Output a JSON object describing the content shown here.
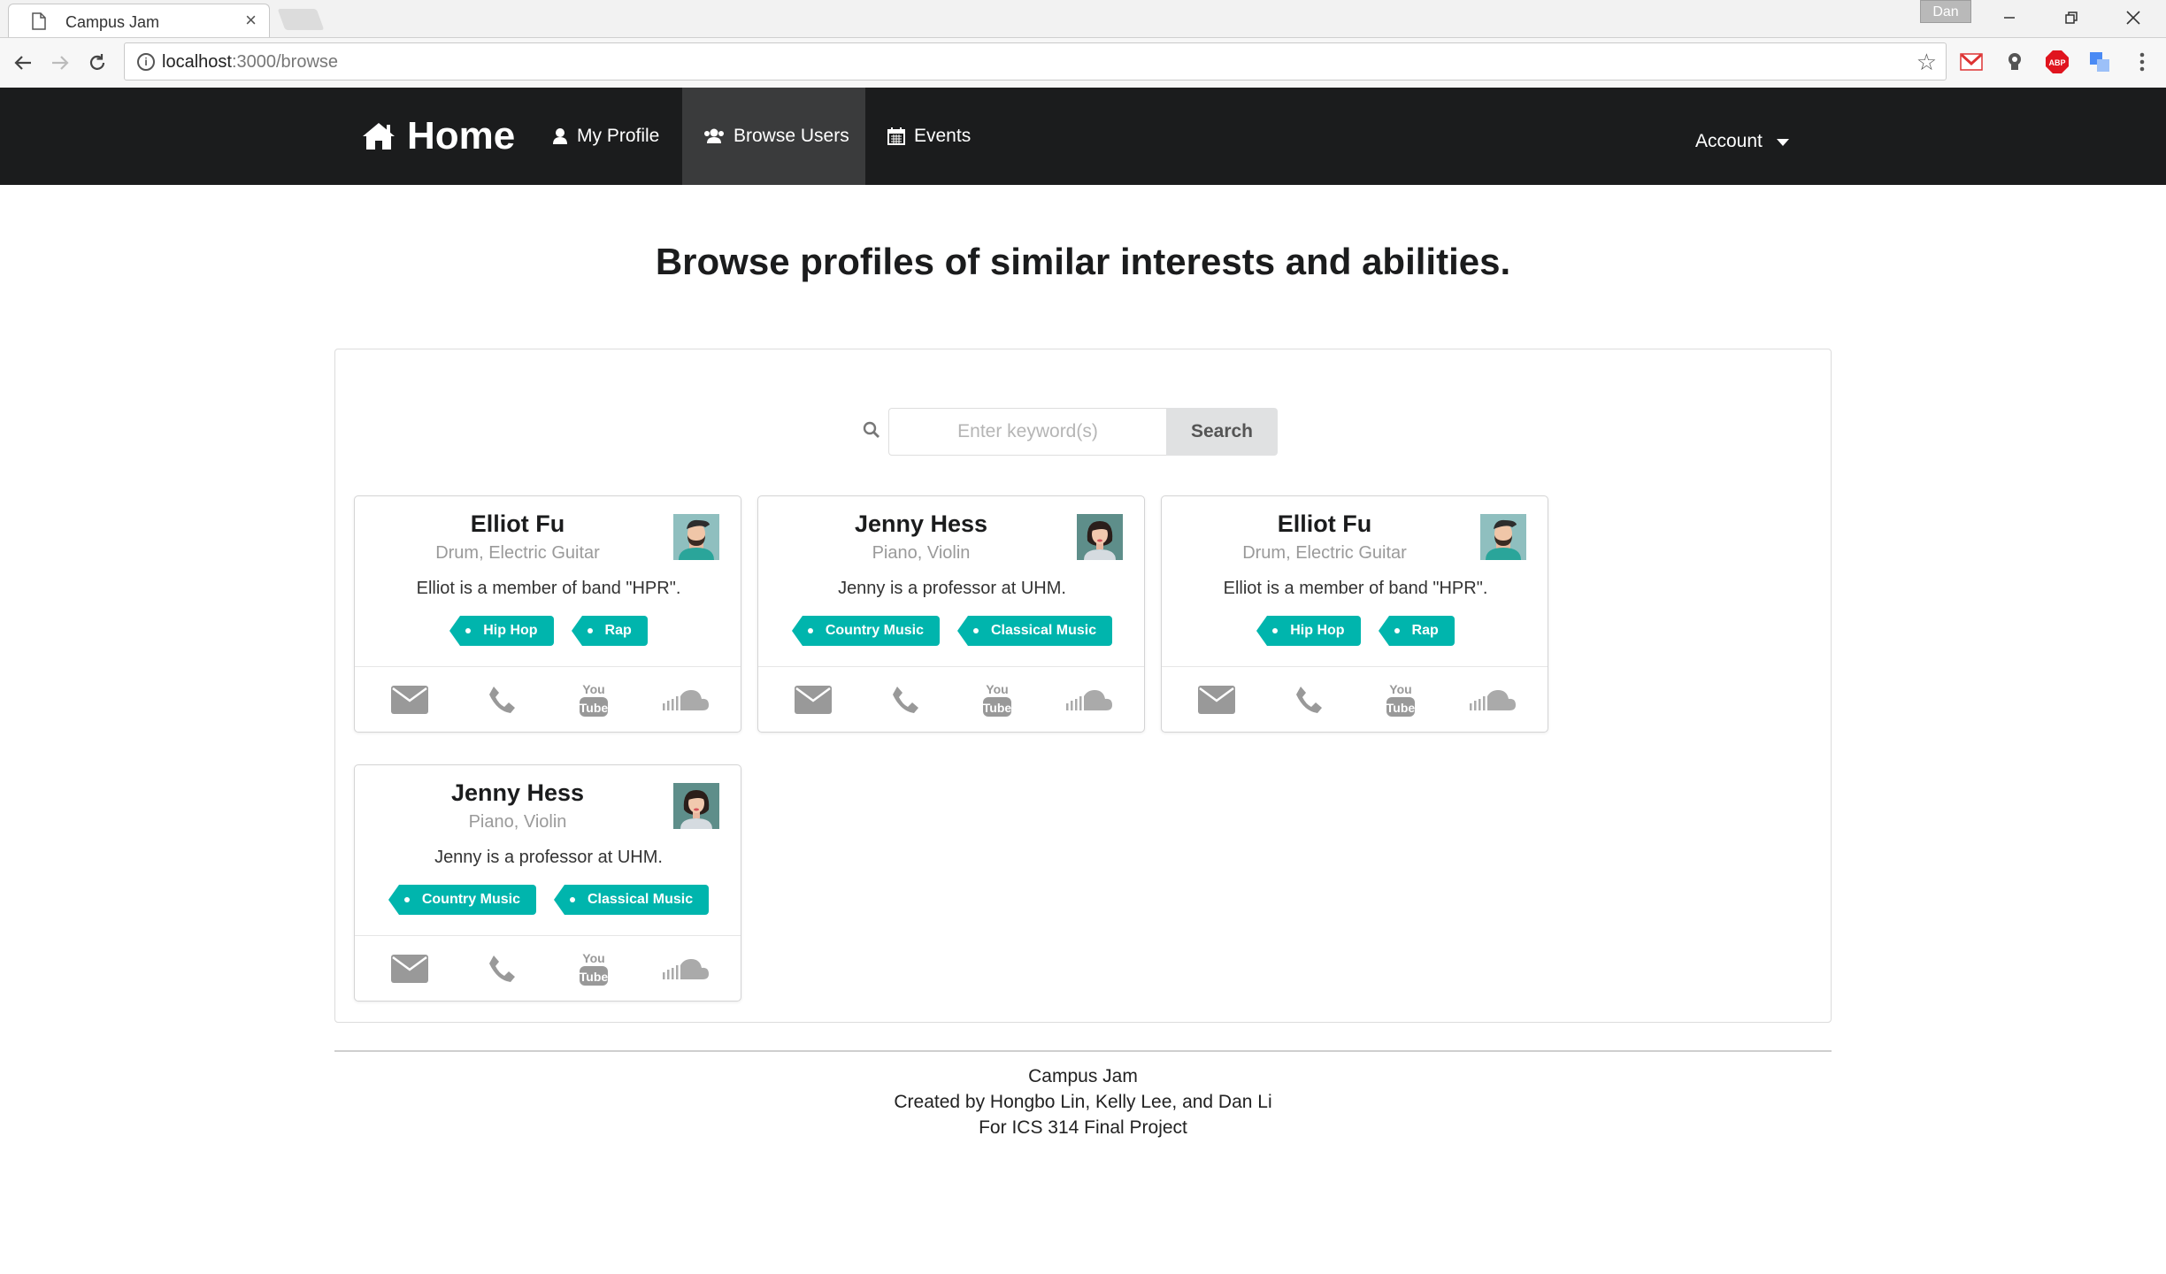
{
  "browser": {
    "tab_title": "Campus Jam",
    "tab_close": "×",
    "profile_badge": "Dan",
    "url_host": "localhost",
    "url_rest": ":3000/browse"
  },
  "navbar": {
    "brand": "Home",
    "items": [
      {
        "label": "My Profile",
        "icon": "user-icon"
      },
      {
        "label": "Browse Users",
        "icon": "users-icon",
        "active": true
      },
      {
        "label": "Events",
        "icon": "calendar-icon"
      }
    ],
    "account": "Account"
  },
  "page": {
    "title": "Browse profiles of similar interests and abilities."
  },
  "search": {
    "placeholder": "Enter keyword(s)",
    "value": "",
    "button": "Search"
  },
  "cards": [
    {
      "name": "Elliot Fu",
      "instruments": "Drum, Electric Guitar",
      "description": "Elliot is a member of band \"HPR\".",
      "tags": [
        "Hip Hop",
        "Rap"
      ],
      "avatar": "male-avatar"
    },
    {
      "name": "Jenny Hess",
      "instruments": "Piano, Violin",
      "description": "Jenny is a professor at UHM.",
      "tags": [
        "Country Music",
        "Classical Music"
      ],
      "avatar": "female-avatar"
    },
    {
      "name": "Elliot Fu",
      "instruments": "Drum, Electric Guitar",
      "description": "Elliot is a member of band \"HPR\".",
      "tags": [
        "Hip Hop",
        "Rap"
      ],
      "avatar": "male-avatar"
    },
    {
      "name": "Jenny Hess",
      "instruments": "Piano, Violin",
      "description": "Jenny is a professor at UHM.",
      "tags": [
        "Country Music",
        "Classical Music"
      ],
      "avatar": "female-avatar"
    }
  ],
  "card_icons": [
    "mail-icon",
    "phone-icon",
    "youtube-icon",
    "soundcloud-icon"
  ],
  "footer": {
    "line1": "Campus Jam",
    "line2": "Created by Hongbo Lin, Kelly Lee, and Dan Li",
    "line3": "For ICS 314 Final Project"
  },
  "colors": {
    "navbar_bg": "#1b1c1d",
    "nav_active_bg": "#3a3b3c",
    "tag_teal": "#00b5ad",
    "search_button_bg": "#e0e1e2"
  }
}
